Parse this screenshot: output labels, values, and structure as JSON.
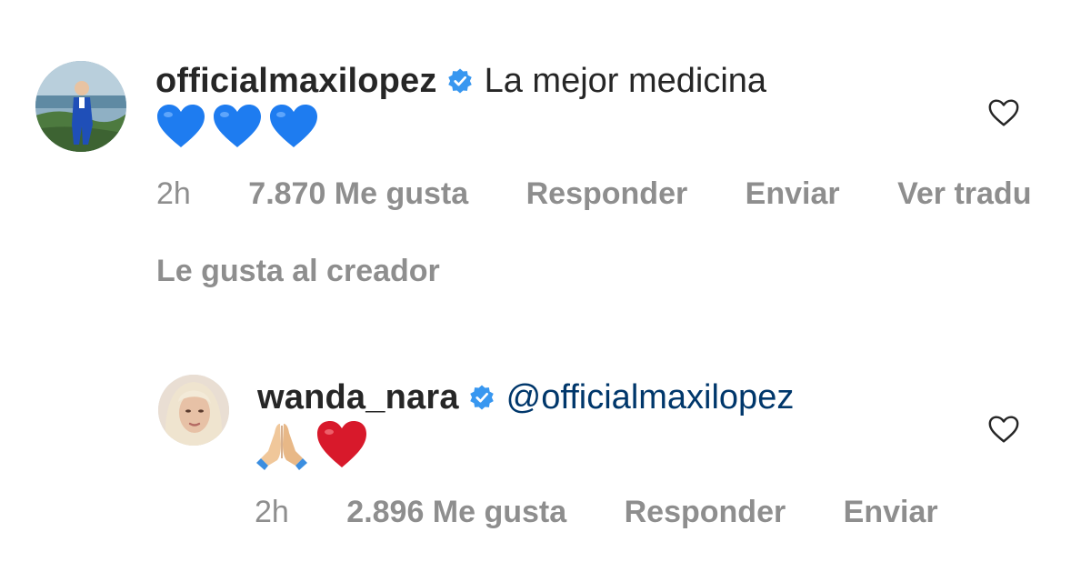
{
  "comments": [
    {
      "username": "officialmaxilopez",
      "text": "La mejor medicina",
      "emojis": "💙💙💙",
      "time": "2h",
      "likes": "7.870 Me gusta",
      "reply": "Responder",
      "send": "Enviar",
      "translate": "Ver tradu",
      "liked_by_creator": "Le gusta al creador"
    },
    {
      "username": "wanda_nara",
      "mention": "@officialmaxilopez",
      "emojis": "🙏🏼❤️",
      "time": "2h",
      "likes": "2.896 Me gusta",
      "reply": "Responder",
      "send": "Enviar"
    }
  ],
  "icons": {
    "verified": "verified-badge-icon",
    "like": "heart-outline-icon"
  },
  "colors": {
    "verified": "#3897f0",
    "mention": "#00376b",
    "secondary_text": "#8e8e8e"
  }
}
